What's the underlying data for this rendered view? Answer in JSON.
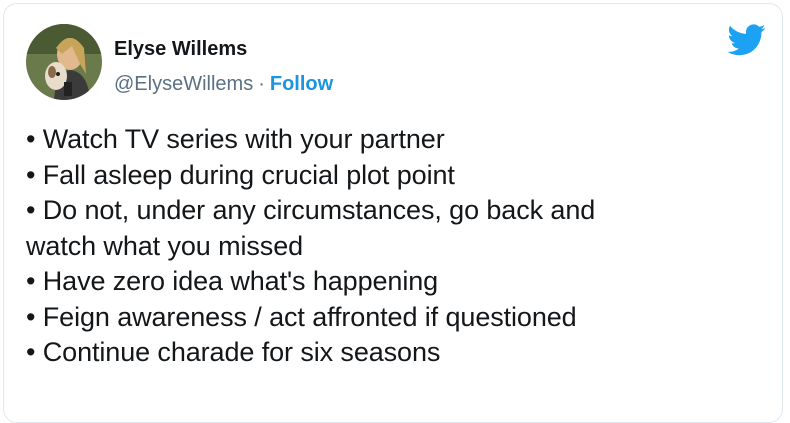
{
  "tweet": {
    "author_name": "Elyse Willems",
    "handle": "@ElyseWillems",
    "separator": "·",
    "follow_label": "Follow",
    "logo_icon": "twitter-bird-icon",
    "brand_color": "#1da1f2",
    "lines": [
      "• Watch TV series with your partner",
      "• Fall asleep during crucial plot point",
      "• Do not, under any circumstances, go back and",
      "watch what you missed",
      "• Have zero idea what's happening",
      "• Feign awareness / act affronted if questioned",
      "• Continue charade for six seasons"
    ]
  }
}
